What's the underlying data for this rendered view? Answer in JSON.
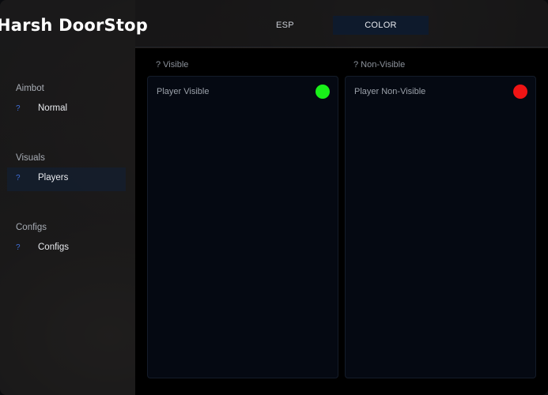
{
  "app": {
    "title": "Harsh DoorStop"
  },
  "tabs": [
    {
      "label": "ESP",
      "active": false
    },
    {
      "label": "COLOR",
      "active": true
    }
  ],
  "sidebar": {
    "sections": [
      {
        "label": "Aimbot",
        "items": [
          {
            "icon": "?",
            "label": "Normal",
            "active": false
          }
        ]
      },
      {
        "label": "Visuals",
        "items": [
          {
            "icon": "?",
            "label": "Players",
            "active": true
          }
        ]
      },
      {
        "label": "Configs",
        "items": [
          {
            "icon": "?",
            "label": "Configs",
            "active": false
          }
        ]
      }
    ]
  },
  "groups": [
    {
      "title": "? Visible",
      "rows": [
        {
          "label": "Player Visible",
          "color": "#19f019"
        }
      ]
    },
    {
      "title": "? Non-Visible",
      "rows": [
        {
          "label": "Player Non-Visible",
          "color": "#f01414"
        }
      ]
    }
  ],
  "colors": {
    "accent": "#3f6ed8",
    "active_tab_bg": "#0e1a2c",
    "panel_bg": "#050912"
  }
}
